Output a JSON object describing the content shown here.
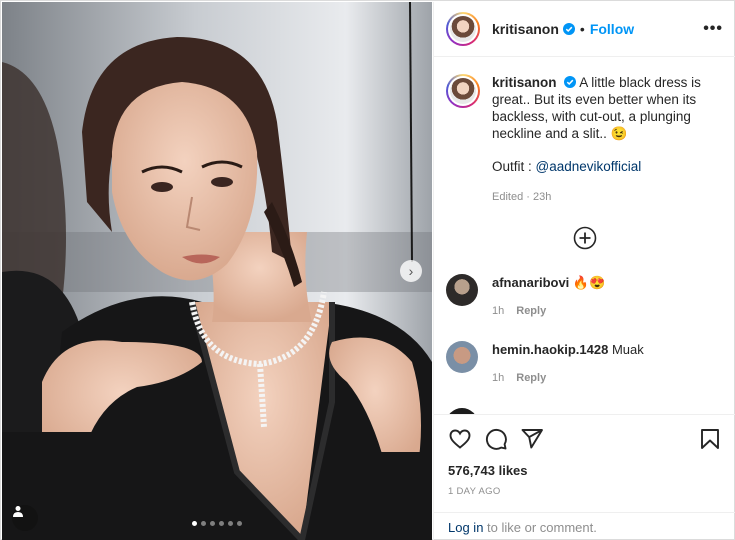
{
  "post": {
    "username": "kritisanon",
    "follow_label": "Follow",
    "more_label": "•••",
    "carousel_dots": 6,
    "active_dot": 0
  },
  "caption": {
    "username": "kritisanon",
    "text": "A little black dress is great.. But its even better when its backless, with cut-out, a plunging neckline and a slit.. 😉",
    "outfit_label": "Outfit : ",
    "outfit_handle": "@aadnevikofficial",
    "meta": "Edited · 23h"
  },
  "comments": [
    {
      "username": "afnanaribovi",
      "text": "🔥😍",
      "time": "1h",
      "reply": "Reply"
    },
    {
      "username": "hemin.haokip.1428",
      "text": "Muak",
      "time": "1h",
      "reply": "Reply"
    }
  ],
  "footer": {
    "likes": "576,743 likes",
    "date": "1 DAY AGO",
    "login_link": "Log in",
    "login_rest": " to like or comment."
  },
  "colors": {
    "accent": "#0095f6",
    "link": "#00376b",
    "muted": "#8e8e8e"
  }
}
